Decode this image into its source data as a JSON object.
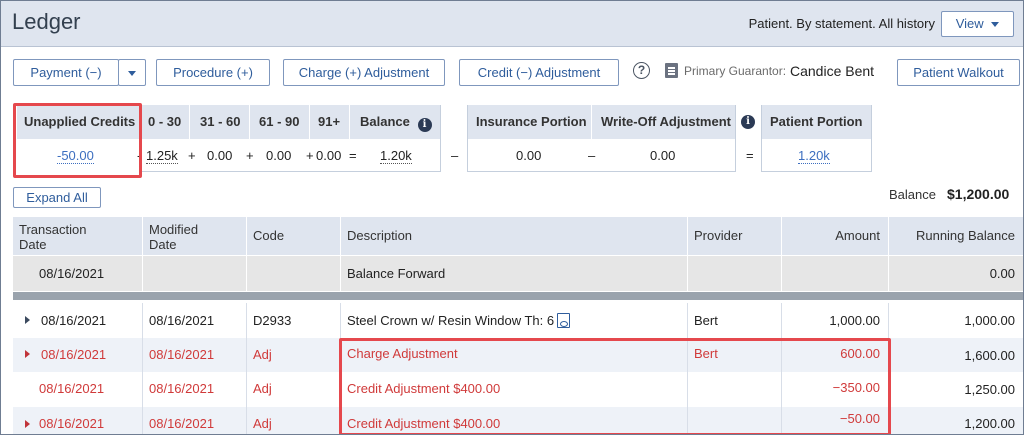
{
  "header": {
    "title": "Ledger",
    "filter_text": "Patient. By statement. All history",
    "view_label": "View"
  },
  "toolbar": {
    "payment_label": "Payment (−)",
    "procedure_label": "Procedure (+)",
    "charge_adj_label": "Charge (+) Adjustment",
    "credit_adj_label": "Credit (−) Adjustment",
    "help_symbol": "?",
    "guarantor_label": "Primary Guarantor:",
    "guarantor_name": "Candice Bent",
    "walkout_label": "Patient Walkout"
  },
  "aging": {
    "headers": {
      "unapplied": "Unapplied Credits",
      "a0_30": "0 - 30",
      "a31_60": "31 - 60",
      "a61_90": "61 - 90",
      "a91": "91+",
      "balance": "Balance",
      "insurance": "Insurance Portion",
      "writeoff": "Write-Off Adjustment",
      "patient": "Patient Portion"
    },
    "values": {
      "unapplied": "-50.00",
      "a0_30": "1.25k",
      "a31_60": "0.00",
      "a61_90": "0.00",
      "a91": "0.00",
      "balance": "1.20k",
      "insurance": "0.00",
      "writeoff": "0.00",
      "patient": "1.20k"
    },
    "ops": {
      "minus": "-",
      "plus": "+",
      "equals": "=",
      "dash": "–"
    },
    "info_symbol": "i"
  },
  "expand_all_label": "Expand All",
  "balance": {
    "label": "Balance",
    "value": "$1,200.00"
  },
  "table": {
    "columns": {
      "tdate_1": "Transaction",
      "tdate_2": "Date",
      "mdate_1": "Modified",
      "mdate_2": "Date",
      "code": "Code",
      "desc": "Description",
      "provider": "Provider",
      "amount": "Amount",
      "running": "Running Balance"
    },
    "forward": {
      "date": "08/16/2021",
      "desc": "Balance Forward",
      "running": "0.00"
    },
    "rows": [
      {
        "tdate": "08/16/2021",
        "mdate": "08/16/2021",
        "code": "D2933",
        "desc": "Steel Crown w/ Resin Window Th: 6",
        "provider": "Bert",
        "amount": "1,000.00",
        "running": "1,000.00"
      },
      {
        "tdate": "08/16/2021",
        "mdate": "08/16/2021",
        "code": "Adj",
        "desc": "Charge Adjustment",
        "provider": "Bert",
        "amount": "600.00",
        "running": "1,600.00"
      },
      {
        "tdate": "08/16/2021",
        "mdate": "08/16/2021",
        "code": "Adj",
        "desc": "Credit Adjustment $400.00",
        "provider": "",
        "amount": "−350.00",
        "running": "1,250.00"
      },
      {
        "tdate": "08/16/2021",
        "mdate": "08/16/2021",
        "code": "Adj",
        "desc": "Credit Adjustment $400.00",
        "provider": "",
        "amount": "−50.00",
        "running": "1,200.00"
      }
    ]
  },
  "colors": {
    "accent": "#2f5d9c",
    "header_bg": "#dfe5ef",
    "highlight": "#e5484d",
    "adjustment_text": "#d03a3a"
  }
}
